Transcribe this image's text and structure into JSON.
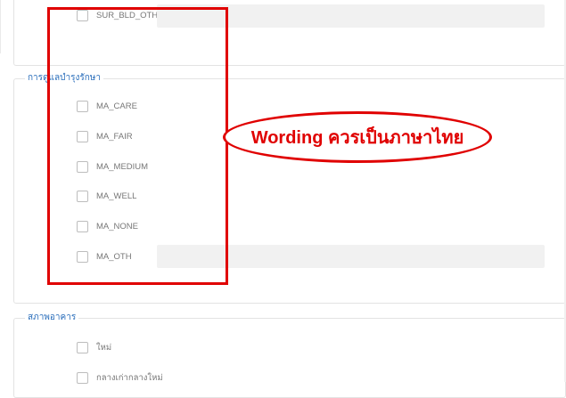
{
  "section_top": {
    "items": [
      {
        "label": "SUR_BLD_OTH"
      }
    ]
  },
  "section_maintenance": {
    "title": "การดูแลบำรุงรักษา",
    "items": [
      {
        "label": "MA_CARE"
      },
      {
        "label": "MA_FAIR"
      },
      {
        "label": "MA_MEDIUM"
      },
      {
        "label": "MA_WELL"
      },
      {
        "label": "MA_NONE"
      },
      {
        "label": "MA_OTH"
      }
    ]
  },
  "section_condition": {
    "title": "สภาพอาคาร",
    "items": [
      {
        "label": "ใหม่"
      },
      {
        "label": "กลางเก่ากลางใหม่"
      }
    ]
  },
  "annotation": {
    "text": "Wording ควรเป็นภาษาไทย",
    "color": "#e00000"
  }
}
